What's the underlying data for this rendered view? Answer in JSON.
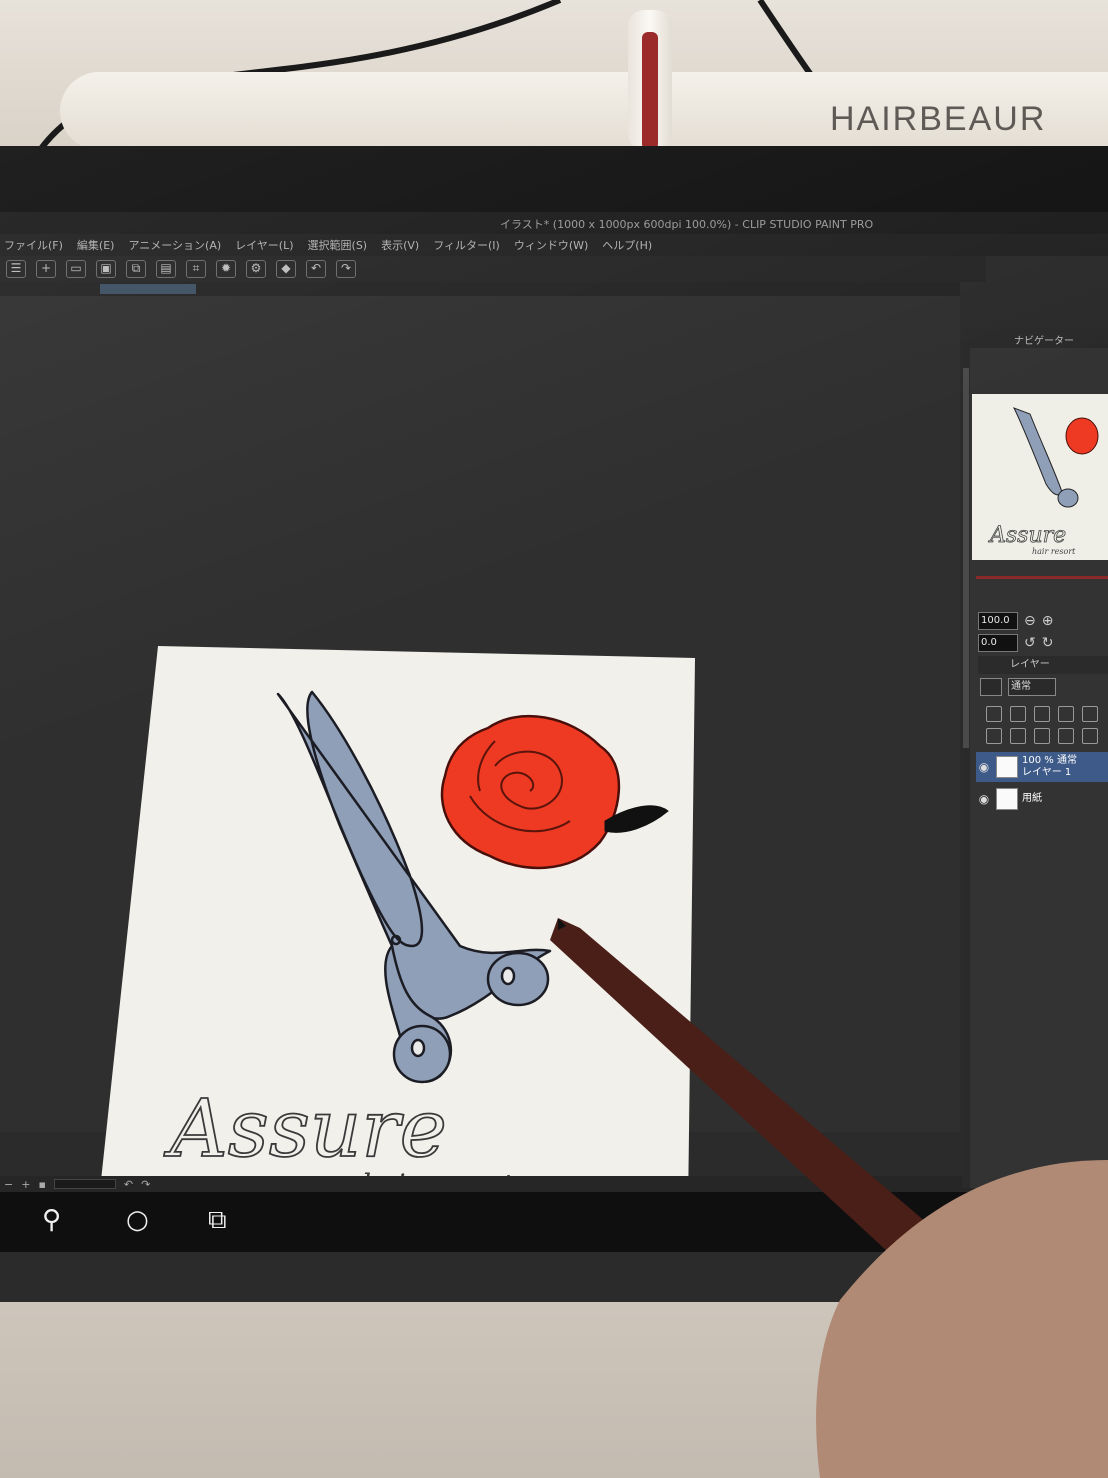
{
  "scene": {
    "background_text": "HAIRBEAUR"
  },
  "app": {
    "title": "イラスト* (1000 x 1000px 600dpi 100.0%) - CLIP STUDIO PAINT PRO",
    "menu": [
      "ファイル(F)",
      "編集(E)",
      "アニメーション(A)",
      "レイヤー(L)",
      "選択範囲(S)",
      "表示(V)",
      "フィルター(I)",
      "ウィンドウ(W)",
      "ヘルプ(H)"
    ],
    "toolbar_icons": [
      "menu-icon",
      "new-icon",
      "open-icon",
      "save-icon",
      "copy-icon",
      "paste-icon",
      "crop-icon",
      "transform-icon",
      "settings-icon",
      "fill-icon",
      "undo-icon",
      "redo-icon"
    ]
  },
  "artwork": {
    "title": "Assure",
    "subtitle": "hair resort",
    "colors": {
      "scissors": "#8f9fb7",
      "rose": "#ee3a22",
      "paper": "#f2f1ec"
    }
  },
  "panel": {
    "navigator_title": "ナビゲーター",
    "zoom_value": "100.0",
    "rotation_value": "0.0",
    "layer_tab": "レイヤー",
    "blend_mode": "通常",
    "layers": [
      {
        "name": "100 % 通常\nレイヤー 1",
        "line1": "100 % 通常",
        "line2": "レイヤー 1",
        "active": true
      },
      {
        "name": "用紙",
        "line1": "",
        "line2": "用紙",
        "active": false
      }
    ],
    "nav_title": "Assure",
    "nav_subtitle": "hair resort"
  },
  "taskbar": {
    "icons": [
      "search-icon",
      "cortana-icon",
      "task-view-icon"
    ]
  }
}
